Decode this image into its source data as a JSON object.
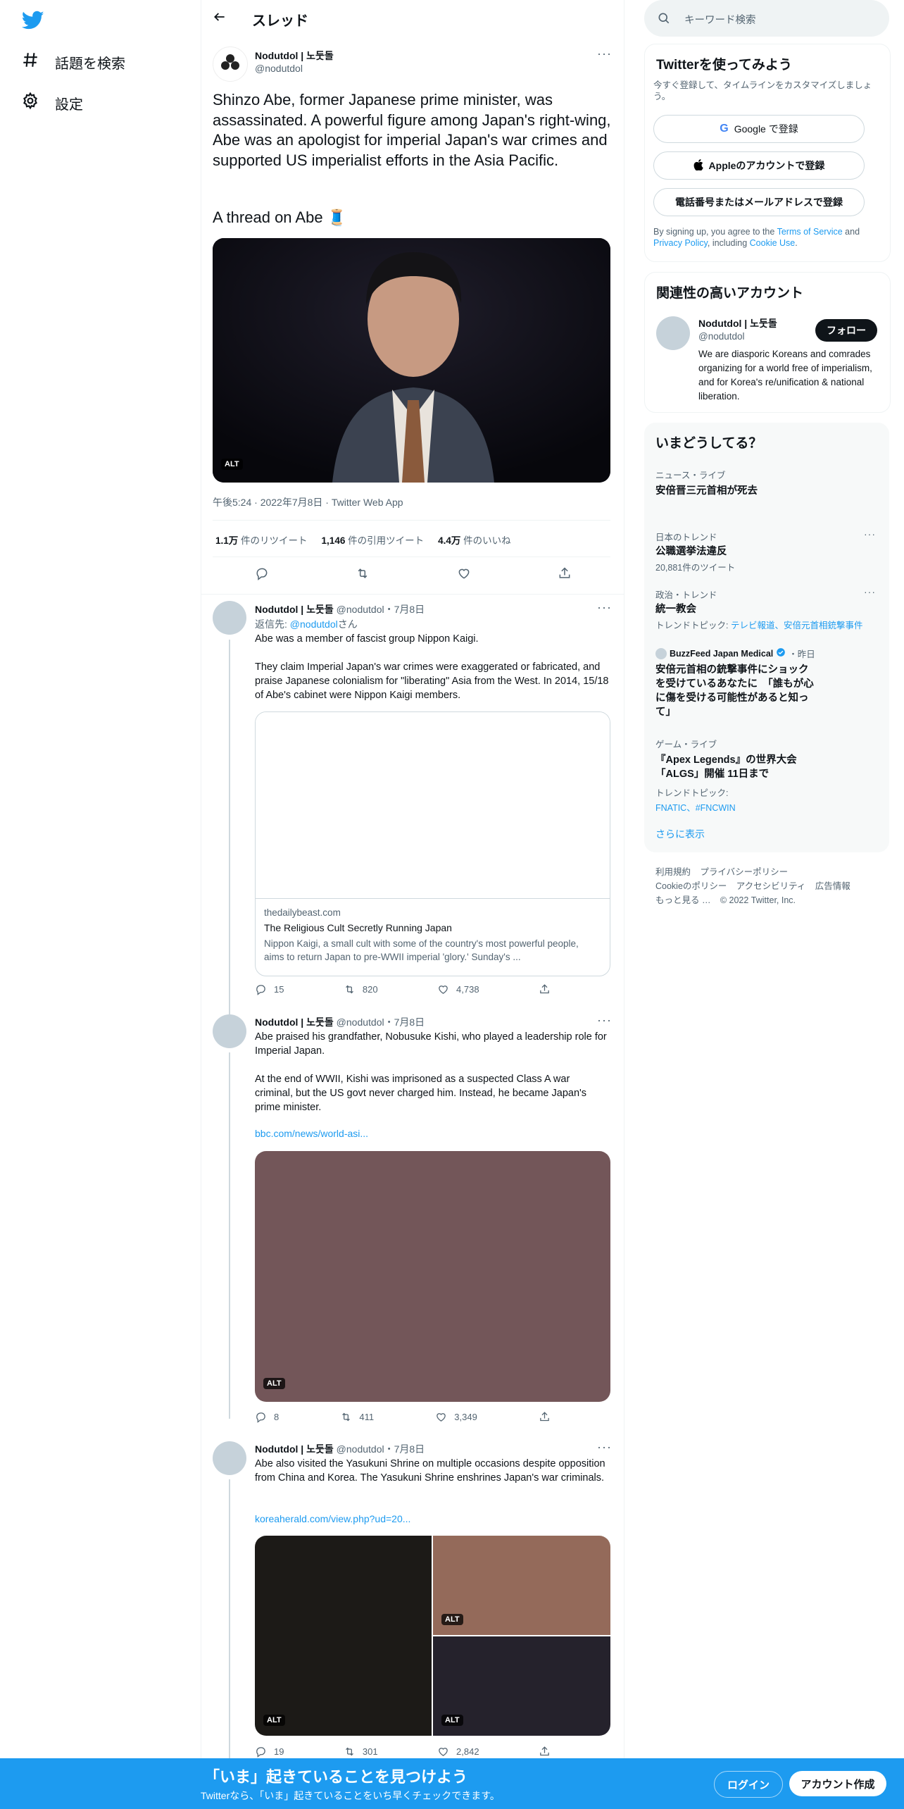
{
  "nav": {
    "logo_icon": "twitter-bird-icon",
    "items": [
      {
        "icon": "hashtag-icon",
        "label": "話題を検索"
      },
      {
        "icon": "gear-icon",
        "label": "設定"
      }
    ]
  },
  "header": {
    "back_icon": "arrow-left-icon",
    "title": "スレッド"
  },
  "main_tweet": {
    "name": "Nodutdol | 노둣돌",
    "handle": "@nodutdol",
    "text": "Shinzo Abe, former Japanese prime minister, was assassinated. A powerful figure among Japan's right-wing, Abe was an apologist for imperial Japan's war crimes and supported US imperialist efforts in the Asia Pacific.",
    "text2": "A thread on Abe 🧵",
    "image_alt": "ALT",
    "meta": "午後5:24 · 2022年7月8日 · Twitter Web App",
    "stats": {
      "retweets": "1.1万",
      "retweets_label": "件のリツイート",
      "quotes": "1,146",
      "quotes_label": "件の引用ツイート",
      "likes": "4.4万",
      "likes_label": "件のいいね"
    }
  },
  "replies": [
    {
      "name": "Nodutdol | 노둣돌",
      "handle": "@nodutdol",
      "date": "・7月8日",
      "reply_prefix": "返信先: ",
      "reply_to": "@nodutdol",
      "reply_suffix": "さん",
      "text": "Abe was a member of fascist group Nippon Kaigi.\n\nThey claim Imperial Japan's war crimes were exaggerated or fabricated, and praise Japanese colonialism for \"liberating\" Asia from the West. In 2014, 15/18 of Abe's cabinet were Nippon Kaigi members.",
      "card": {
        "domain": "thedailybeast.com",
        "title": "The Religious Cult Secretly Running Japan",
        "desc": "Nippon Kaigi, a small cult with some of the country's most powerful people, aims to return Japan to pre-WWII imperial 'glory.' Sunday's ..."
      },
      "counts": {
        "reply": "15",
        "retweet": "820",
        "like": "4,738"
      }
    },
    {
      "name": "Nodutdol | 노둣돌",
      "handle": "@nodutdol",
      "date": "・7月8日",
      "text": "Abe praised his grandfather, Nobusuke Kishi, who played a leadership role for Imperial Japan.\n\nAt the end of WWII, Kishi was imprisoned as a suspected Class A war criminal, but the US govt never charged him. Instead, he became Japan's prime minister.",
      "link": "bbc.com/news/world-asi...",
      "image_alt": "ALT",
      "image_color": "#735659",
      "counts": {
        "reply": "8",
        "retweet": "411",
        "like": "3,349"
      }
    },
    {
      "name": "Nodutdol | 노둣돌",
      "handle": "@nodutdol",
      "date": "・7月8日",
      "text": "Abe also visited the Yasukuni Shrine on multiple occasions despite opposition from China and Korea. The Yasukuni Shrine enshrines Japan's war criminals.",
      "link": "koreaherald.com/view.php?ud=20...",
      "images": [
        {
          "alt": "ALT",
          "color": "#1c1a17"
        },
        {
          "alt": "ALT",
          "color": "#946a5a"
        },
        {
          "alt": "ALT",
          "color": "#25222c"
        }
      ],
      "counts": {
        "reply": "19",
        "retweet": "301",
        "like": "2,842"
      }
    }
  ],
  "search": {
    "placeholder": "キーワード検索",
    "icon": "search-icon"
  },
  "signup": {
    "title": "Twitterを使ってみよう",
    "subtitle": "今すぐ登録して、タイムラインをカスタマイズしましょう。",
    "google": "Google で登録",
    "apple": "Appleのアカウントで登録",
    "phone": "電話番号またはメールアドレスで登録",
    "terms_pre": "By signing up, you agree to the ",
    "terms_link": "Terms of Service",
    "terms_and": " and ",
    "privacy_link": "Privacy Policy",
    "terms_mid": ", including ",
    "cookie_link": "Cookie Use",
    "terms_end": "."
  },
  "related": {
    "title": "関連性の高いアカウント",
    "name": "Nodutdol | 노둣돌",
    "handle": "@nodutdol",
    "follow": "フォロー",
    "bio": "We are diasporic Koreans and comrades organizing for a world free of imperialism, and for Korea's re/unification & national liberation."
  },
  "trends": {
    "title": "いまどうしてる？",
    "items": [
      {
        "category": "ニュース・ライブ",
        "title": "安倍晋三元首相が死去"
      },
      {
        "category": "日本のトレンド",
        "title": "公職選挙法違反",
        "sub": "20,881件のツイート"
      },
      {
        "category": "政治・トレンド",
        "title": "統一教会",
        "topic_label": "トレンドトピック: ",
        "topic_links": "テレビ報道、安倍元首相銃撃事件"
      },
      {
        "source": "BuzzFeed Japan Medical",
        "time": "・昨日",
        "title": "安倍元首相の銃撃事件にショックを受けているあなたに　「誰もが心に傷を受ける可能性があると知って」"
      },
      {
        "category": "ゲーム・ライブ",
        "title": "『Apex Legends』の世界大会「ALGS」開催 11日まで",
        "topic_label": "トレンドトピック:",
        "topic_links": "FNATIC、#FNCWIN"
      }
    ],
    "more": "さらに表示"
  },
  "footer": {
    "terms": "利用規約",
    "privacy": "プライバシーポリシー",
    "cookie": "Cookieのポリシー",
    "accessibility": "アクセシビリティ",
    "ads": "広告情報",
    "more": "もっと見る …",
    "copyright": "© 2022 Twitter, Inc."
  },
  "bottombar": {
    "title": "「いま」起きていることを見つけよう",
    "subtitle": "Twitterなら、「いま」起きていることをいち早くチェックできます。",
    "login": "ログイン",
    "signup": "アカウント作成"
  },
  "colors": {
    "accent": "#1d9bf0",
    "text": "#0f1419",
    "muted": "#536471"
  }
}
